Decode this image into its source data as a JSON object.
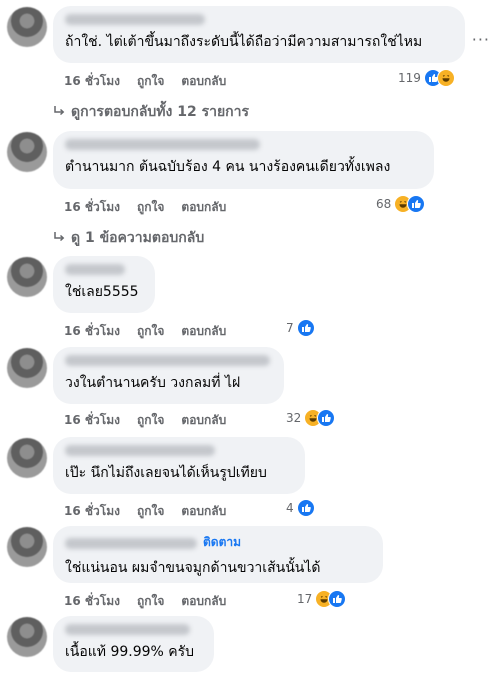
{
  "comments": [
    {
      "text": "ถ้าใช่. ไต่เต้าขึ้นมาถึงระดับนี้ได้ถือว่ามีความสามารถใช่ไหม",
      "time": "16 ชั่วโมง",
      "like": "ถูกใจ",
      "reply": "ตอบกลับ",
      "count": "119",
      "reactions": [
        "like",
        "haha"
      ]
    },
    {
      "text": "ตำนานมาก ต้นฉบับร้อง 4 คน นางร้องคนเดียวทั้งเพลง",
      "time": "16 ชั่วโมง",
      "like": "ถูกใจ",
      "reply": "ตอบกลับ",
      "count": "68",
      "reactions": [
        "haha",
        "like"
      ]
    },
    {
      "text": "ใช่เลย5555",
      "time": "16 ชั่วโมง",
      "like": "ถูกใจ",
      "reply": "ตอบกลับ",
      "count": "7",
      "reactions": [
        "like"
      ]
    },
    {
      "text": "วงในตำนานครับ วงกลมที่ ไฝ",
      "time": "16 ชั่วโมง",
      "like": "ถูกใจ",
      "reply": "ตอบกลับ",
      "count": "32",
      "reactions": [
        "haha",
        "like"
      ]
    },
    {
      "text": "เป๊ะ นึกไม่ถึงเลยจนได้เห็นรูปเทียบ",
      "time": "16 ชั่วโมง",
      "like": "ถูกใจ",
      "reply": "ตอบกลับ",
      "count": "4",
      "reactions": [
        "like"
      ]
    },
    {
      "text": "ใช่แน่นอน ผมจำขนจมูกด้านขวาเส้นนั้นได้",
      "follow": "ติดตาม",
      "time": "16 ชั่วโมง",
      "like": "ถูกใจ",
      "reply": "ตอบกลับ",
      "count": "17",
      "reactions": [
        "haha",
        "like"
      ]
    },
    {
      "text": "เนื้อแท้ 99.99% ครับ"
    }
  ],
  "replies": [
    {
      "label": "ดูการตอบกลับทั้ง 12 รายการ"
    },
    {
      "label": "ดู 1 ข้อความตอบกลับ"
    }
  ],
  "more_label": "···"
}
